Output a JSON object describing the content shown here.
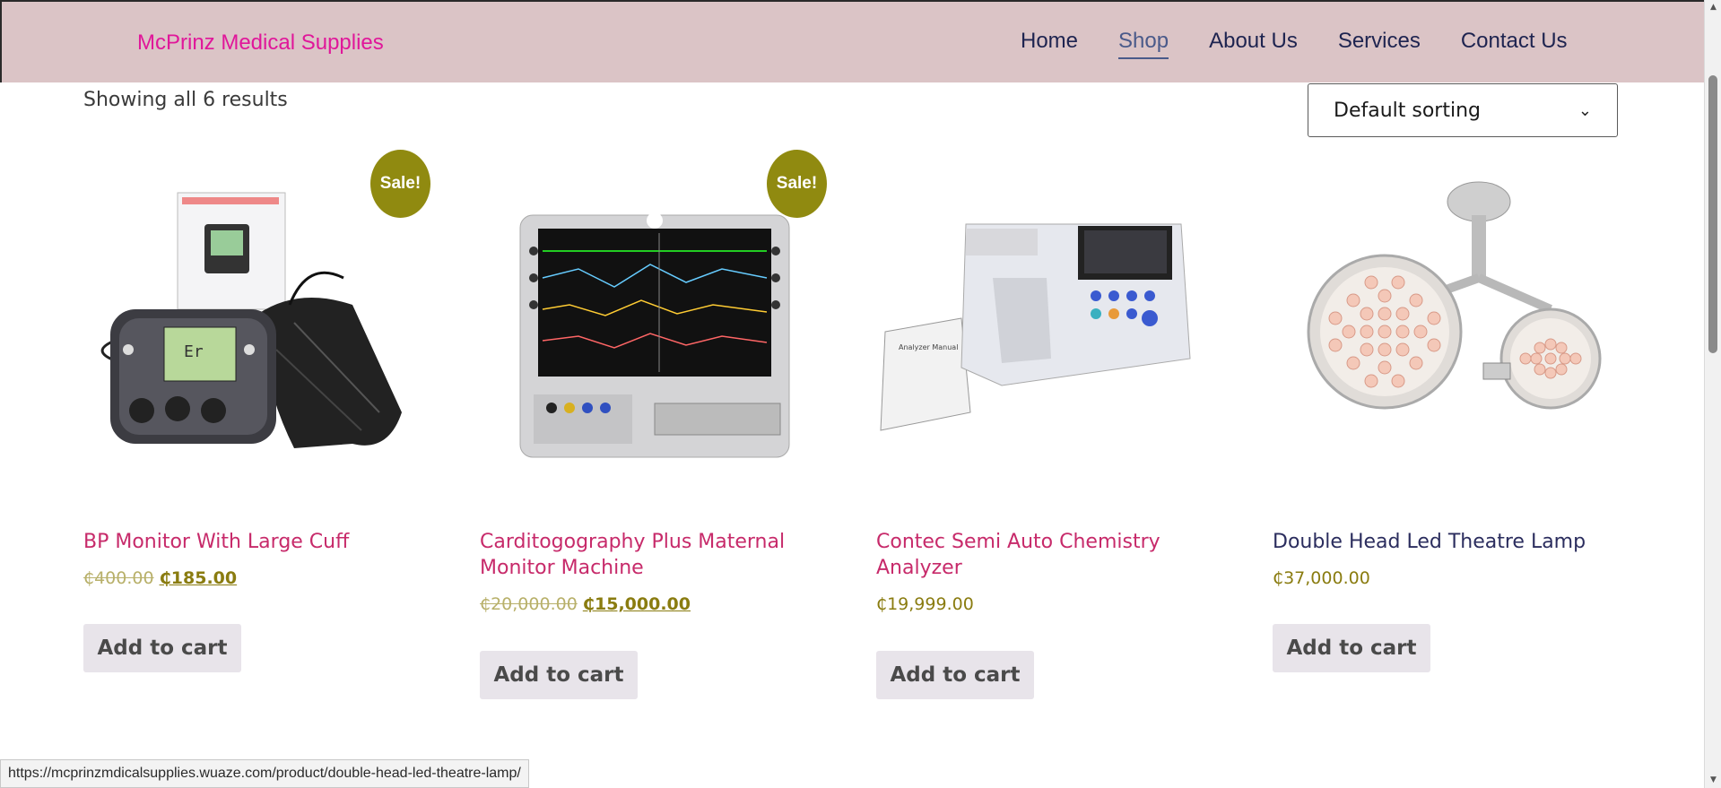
{
  "header": {
    "brand": "McPrinz Medical Supplies",
    "nav": [
      "Home",
      "Shop",
      "About Us",
      "Services",
      "Contact Us"
    ],
    "active_nav": "Shop"
  },
  "shop": {
    "result_count": "Showing all 6 results",
    "sort_selected": "Default sorting"
  },
  "products": [
    {
      "title": "BP Monitor With Large Cuff",
      "sale_badge": "Sale!",
      "old_price": "₵400.00",
      "price": "₵185.00",
      "button": "Add to cart"
    },
    {
      "title": "Carditogography Plus Maternal Monitor Machine",
      "sale_badge": "Sale!",
      "old_price": "₵20,000.00",
      "price": "₵15,000.00",
      "button": "Add to cart"
    },
    {
      "title": "Contec Semi Auto Chemistry Analyzer",
      "price": "₵19,999.00",
      "button": "Add to cart"
    },
    {
      "title": "Double Head Led Theatre Lamp",
      "price": "₵37,000.00",
      "button": "Add to cart"
    }
  ],
  "status_bar": {
    "url": "https://mcprinzmdicalsupplies.wuaze.com/product/double-head-led-theatre-lamp/"
  },
  "colors": {
    "header_bg": "#dbc4c6",
    "brand": "#e0179a",
    "product_title": "#c72a6a",
    "sale_badge": "#908a10",
    "price": "#8a7c10"
  }
}
